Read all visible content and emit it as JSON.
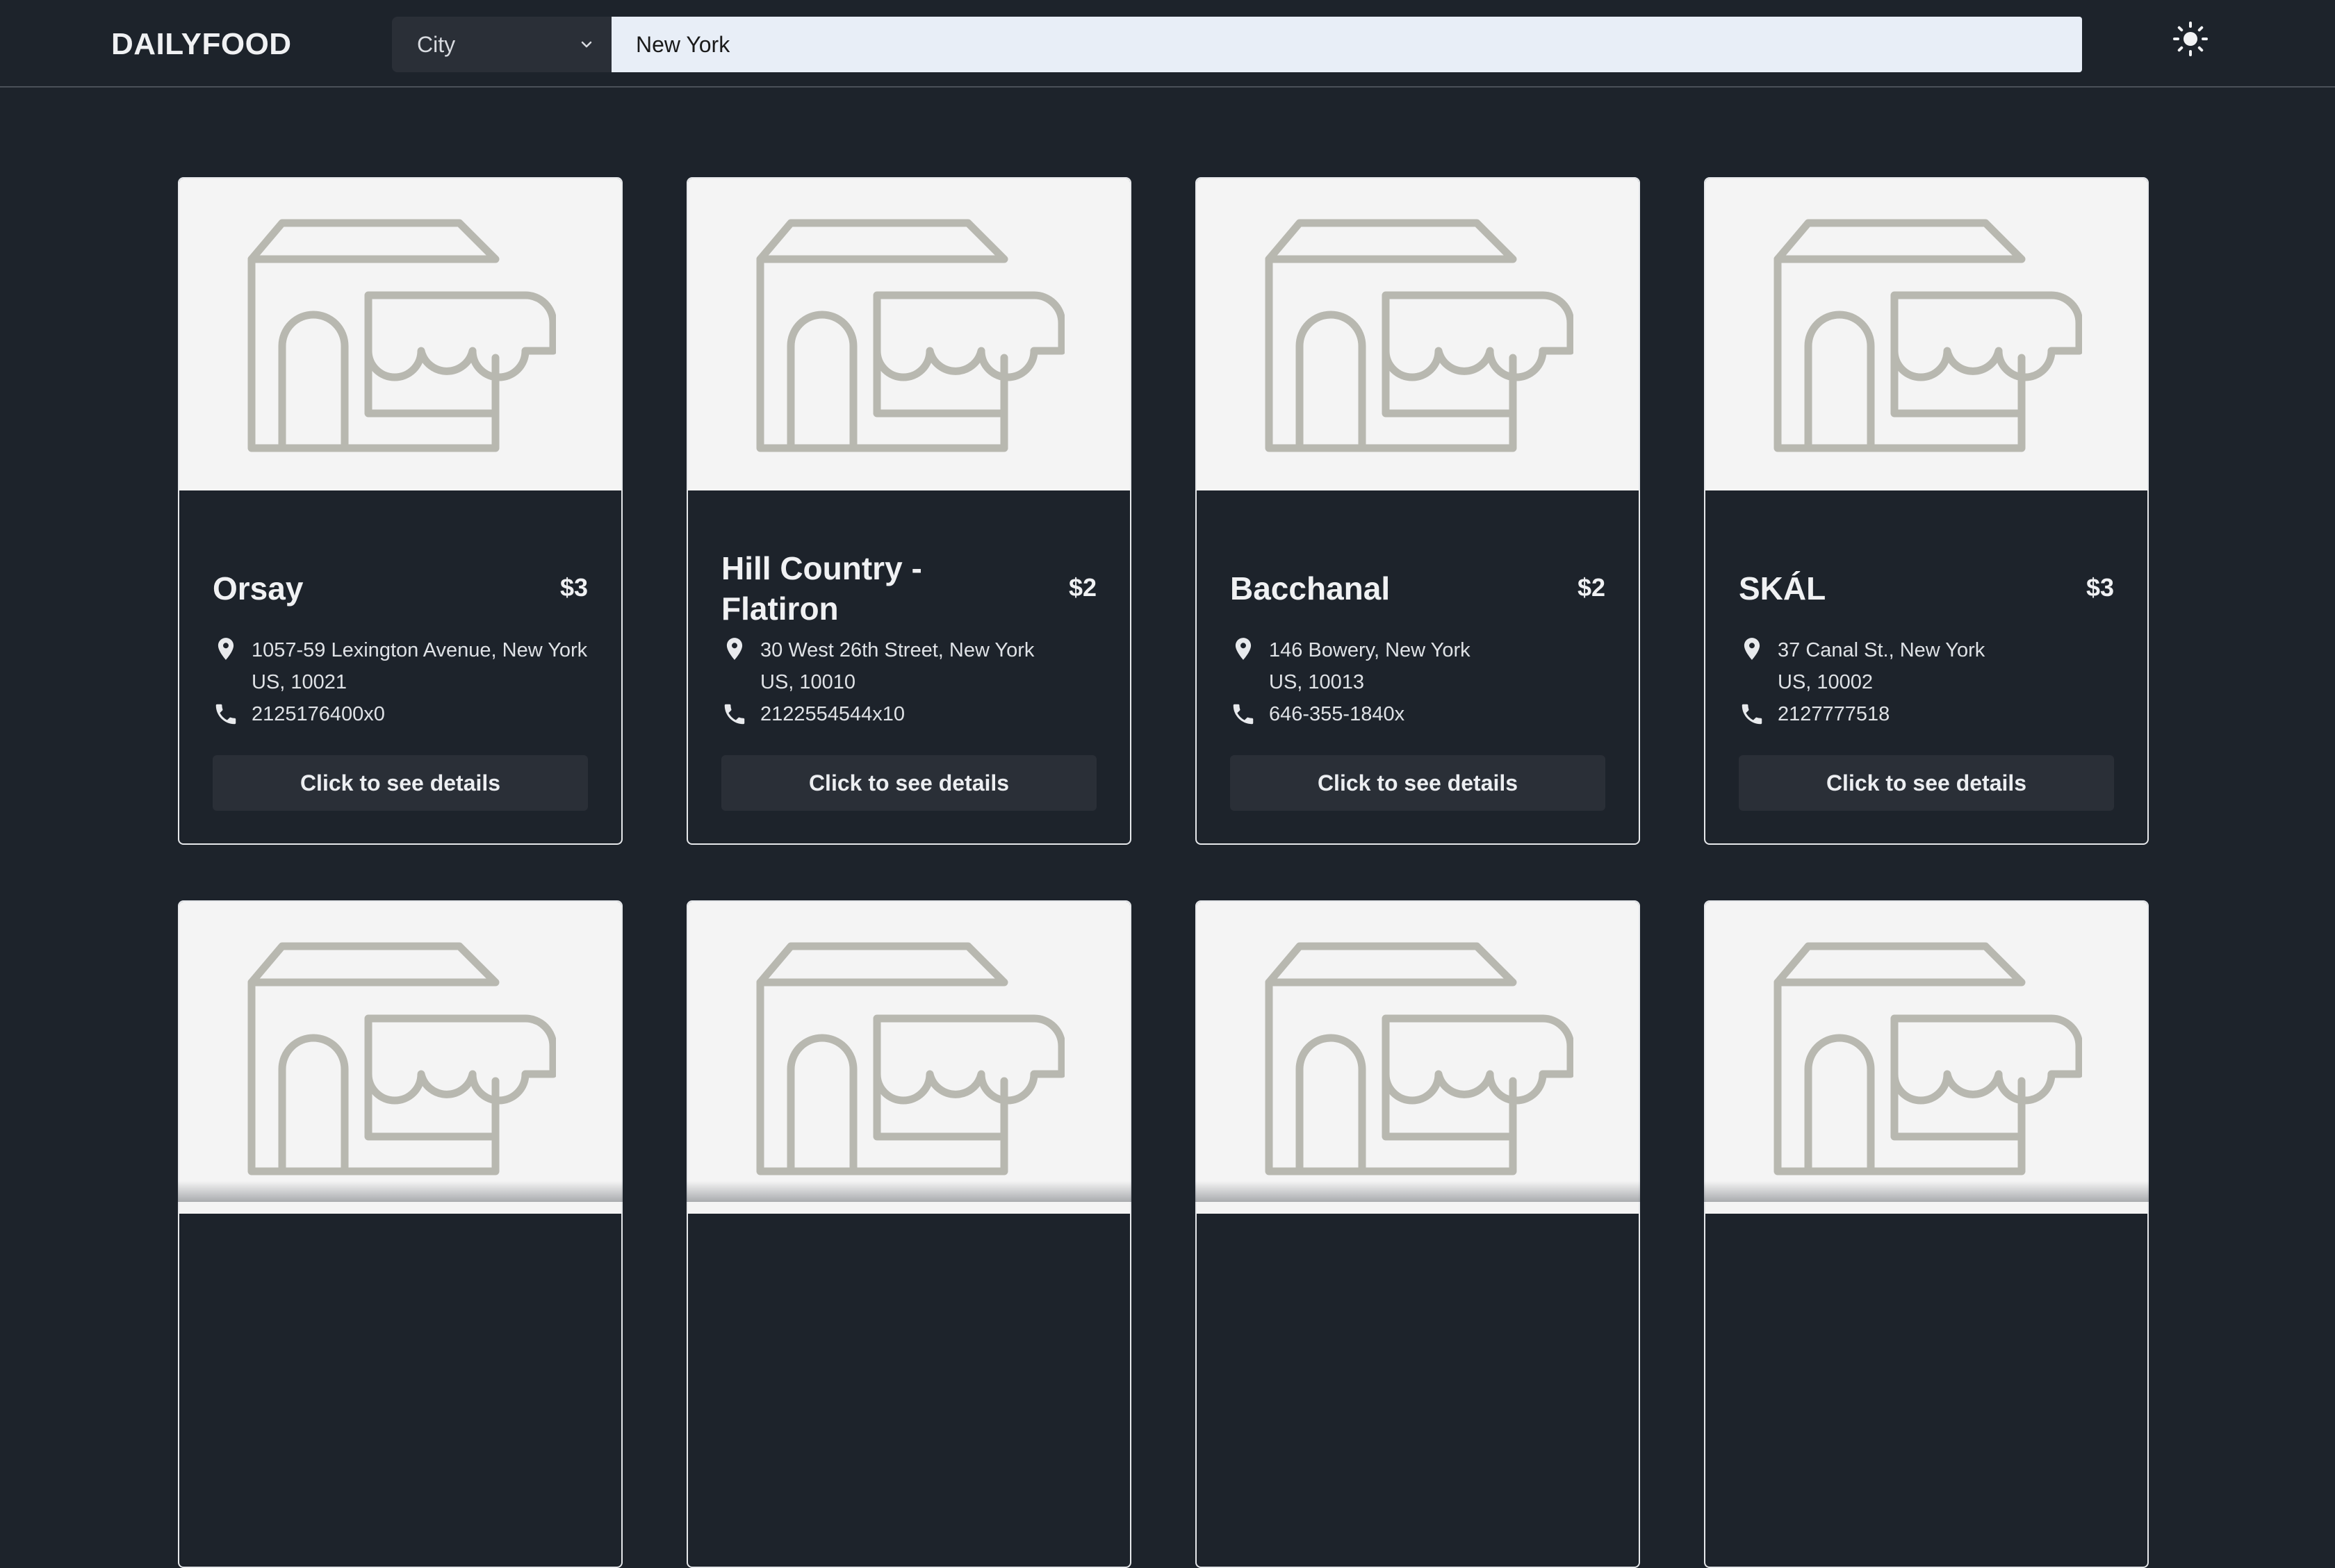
{
  "header": {
    "logo": "DAILYFOOD",
    "filter_select": {
      "selected": "City"
    },
    "search": {
      "value": "New York",
      "placeholder": ""
    },
    "theme_toggle_icon": "sun-icon"
  },
  "restaurants": [
    {
      "name": "Orsay",
      "price": "$3",
      "address_line1": "1057-59 Lexington Avenue, New York",
      "address_line2": "US, 10021",
      "phone": "2125176400x0",
      "button": "Click to see details"
    },
    {
      "name": "Hill Country - Flatiron",
      "price": "$2",
      "address_line1": "30 West 26th Street, New York",
      "address_line2": "US, 10010",
      "phone": "2122554544x10",
      "button": "Click to see details"
    },
    {
      "name": "Bacchanal",
      "price": "$2",
      "address_line1": "146 Bowery, New York",
      "address_line2": "US, 10013",
      "phone": "646-355-1840x",
      "button": "Click to see details"
    },
    {
      "name": "SKÁL",
      "price": "$3",
      "address_line1": "37 Canal St., New York",
      "address_line2": "US, 10002",
      "phone": "2127777518",
      "button": "Click to see details"
    }
  ],
  "colors": {
    "background": "#1d232b",
    "card_border": "#e6e8eb",
    "image_placeholder_bg": "#f4f4f4",
    "store_icon": "#b8b8b0",
    "button_bg": "#2a2f37"
  },
  "icons": {
    "store": "storefront-icon",
    "address": "map-pin-icon",
    "phone": "phone-icon",
    "dropdown": "chevron-down-icon"
  }
}
